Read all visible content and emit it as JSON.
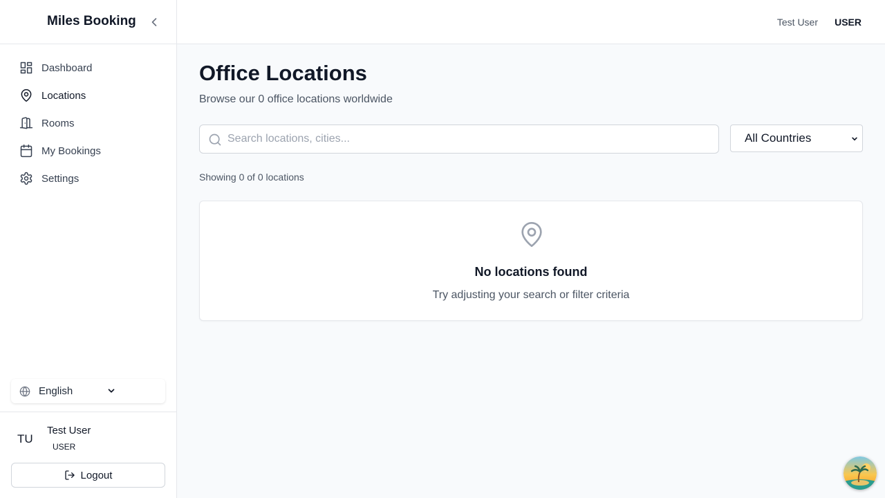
{
  "app": {
    "title": "Miles Booking"
  },
  "sidebar": {
    "items": [
      {
        "label": "Dashboard",
        "icon": "dashboard-icon"
      },
      {
        "label": "Locations",
        "icon": "map-pin-icon",
        "active": true
      },
      {
        "label": "Rooms",
        "icon": "door-icon"
      },
      {
        "label": "My Bookings",
        "icon": "calendar-icon"
      },
      {
        "label": "Settings",
        "icon": "gear-icon"
      }
    ],
    "language": "English",
    "user": {
      "initials": "TU",
      "name": "Test User",
      "role": "USER"
    },
    "logout_label": "Logout"
  },
  "header": {
    "user_name": "Test User",
    "role": "USER"
  },
  "main": {
    "title": "Office Locations",
    "subtitle": "Browse our 0 office locations worldwide",
    "search": {
      "placeholder": "Search locations, cities...",
      "value": ""
    },
    "country_filter": {
      "selected": "All Countries"
    },
    "showing": "Showing 0 of 0 locations",
    "empty_state": {
      "icon": "map-pin-icon",
      "title": "No locations found",
      "message": "Try adjusting your search or filter criteria"
    }
  },
  "colors": {
    "text": "#111827",
    "muted": "#4b5563",
    "border": "#e5e7eb",
    "background": "#f8fafc"
  }
}
